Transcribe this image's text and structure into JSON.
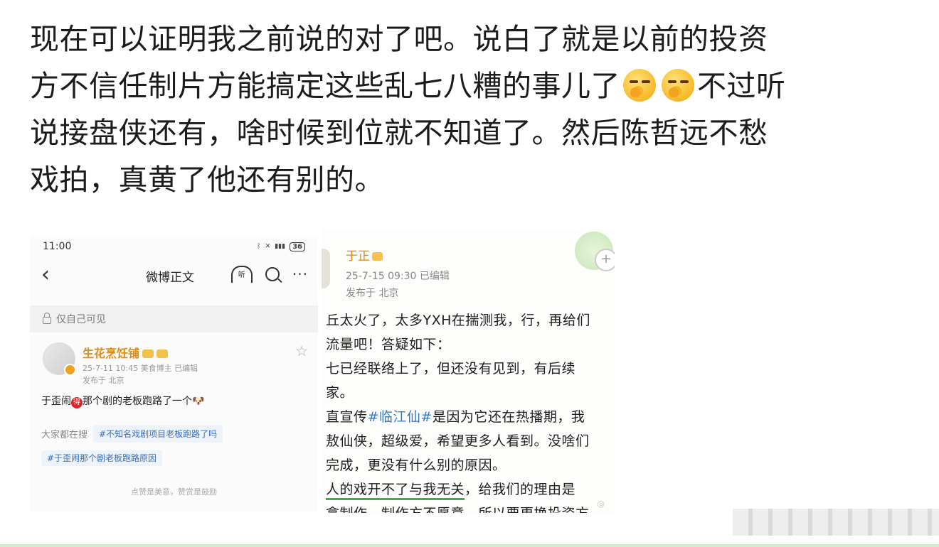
{
  "post": {
    "line1": "现在可以证明我之前说的对了吧。说白了就是以前的投资",
    "line2a": "方不信任制片方能搞定这些乱七八糟的事儿了",
    "line2b": "不过听",
    "line3": "说接盘侠还有，啥时候到位就不知道了。然后陈哲远不愁",
    "line4": "戏拍，真黄了他还有别的。",
    "emoji": "thinking-face"
  },
  "shot1": {
    "status_time": "11:00",
    "battery": "36",
    "nav_title": "微博正文",
    "listen_label": "听",
    "private_label": "仅自己可见",
    "author": "生花烹饪铺",
    "meta": "25-7-11 10:45  美食博主  已编辑",
    "location": "发布于 北京",
    "content_pre": "于歪闹",
    "content_badge": "得",
    "content_post": "那个剧的老板跑路了一个",
    "search_label": "大家都在搜",
    "topic1": "#不知名戏剧项目老板跑路了吗",
    "topic2": "#于歪闹那个剧老板跑路原因",
    "footer": "点赞是美意，赞赏是鼓励"
  },
  "shot2": {
    "author": "于正",
    "meta": "25-7-15 09:30   已编辑",
    "location": "发布于 北京",
    "lines": [
      "丘太火了，太多YXH在揣测我，行，再给们",
      "流量吧！答疑如下：",
      "七已经联络上了，但还没有见到，有后续",
      "家。",
      "直宣传",
      "是因为它还在热播期，我",
      "敖仙侠，超级爱，希望更多人看到。没啥们",
      "完成，更没有什么别的原因。",
      "人的戏开不了与我无关",
      "，给我们的理由是",
      "拿制作，制作方不愿意，所以要更换投资方"
    ],
    "hashtag": "#临江仙#",
    "plus": "+"
  }
}
